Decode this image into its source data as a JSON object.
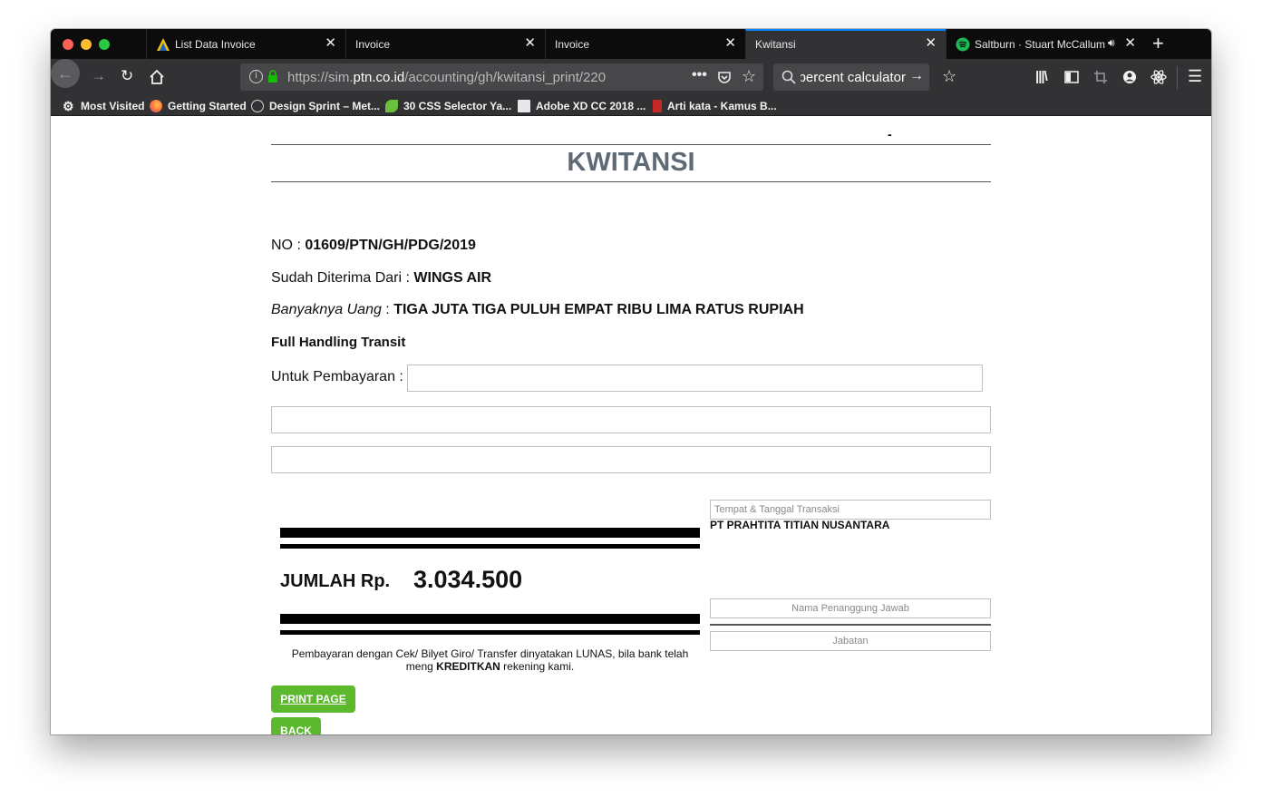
{
  "tabs": [
    {
      "title": "List Data Invoice",
      "icon": "ptn-logo-icon",
      "active": false
    },
    {
      "title": "Invoice",
      "active": false
    },
    {
      "title": "Invoice",
      "active": false
    },
    {
      "title": "Kwitansi",
      "active": true
    },
    {
      "title": "Saltburn · Stuart McCallum",
      "icon": "spotify-icon",
      "playing": true,
      "active": false
    }
  ],
  "navbar": {
    "url_prefix": "https://sim.",
    "url_host": "ptn.co.id",
    "url_path": "/accounting/gh/kwitansi_print/220",
    "search_value": "percent calculator"
  },
  "bookmarks": [
    {
      "label": "Most Visited",
      "icon": "gear-icon"
    },
    {
      "label": "Getting Started",
      "icon": "firefox-icon"
    },
    {
      "label": "Design Sprint – Met...",
      "icon": "globe-icon"
    },
    {
      "label": "30 CSS Selector Ya...",
      "icon": "leaf-icon"
    },
    {
      "label": "Adobe XD CC 2018 ...",
      "icon": "document-icon"
    },
    {
      "label": "Arti kata - Kamus B...",
      "icon": "book-icon"
    }
  ],
  "doc": {
    "dash": "-",
    "title": "KWITANSI",
    "no_label": "NO : ",
    "no_value": "01609/PTN/GH/PDG/2019",
    "received_label": "Sudah Diterima Dari : ",
    "received_value": "WINGS AIR",
    "amount_label": "Banyaknya Uang",
    "amount_sep": " : ",
    "amount_words": "TIGA JUTA TIGA PULUH EMPAT RIBU LIMA RATUS RUPIAH",
    "service": "Full Handling Transit",
    "payment_label": "Untuk Pembayaran :",
    "jumlah_label": "JUMLAH Rp.",
    "jumlah_value": "3.034.500",
    "note_part1": "Pembayaran dengan Cek/ Bilyet Giro/ Transfer dinyatakan LUNAS, bila bank telah meng ",
    "note_bold": "KREDITKAN",
    "note_part2": " rekening kami.",
    "place_date_placeholder": "Tempat & Tanggal Transaksi",
    "company": "PT PRAHTITA TITIAN NUSANTARA",
    "name_placeholder": "Nama Penanggung Jawab",
    "position_placeholder": "Jabatan",
    "print_button": "PRINT PAGE",
    "back_button": "BACK"
  },
  "colors": {
    "accent_tab": "#0a84ff",
    "title_gray": "#5e6a76",
    "button_green": "#5cb82c",
    "tabstrip_bg": "#0c0c0d",
    "toolbar_bg": "#323234"
  }
}
